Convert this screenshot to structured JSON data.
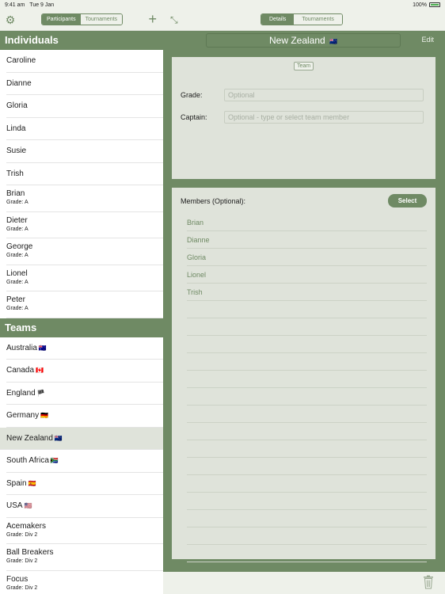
{
  "status_bar": {
    "time": "9:41 am",
    "date": "Tue 9 Jan",
    "battery": "100%"
  },
  "left_nav": {
    "segments": [
      "Participants",
      "Tournaments"
    ],
    "active_segment": 0,
    "add_symbol": "+"
  },
  "individuals": {
    "header": "Individuals",
    "items": [
      {
        "name": "Caroline",
        "grade": ""
      },
      {
        "name": "Dianne",
        "grade": ""
      },
      {
        "name": "Gloria",
        "grade": ""
      },
      {
        "name": "Linda",
        "grade": ""
      },
      {
        "name": "Susie",
        "grade": ""
      },
      {
        "name": "Trish",
        "grade": ""
      },
      {
        "name": "Brian",
        "grade": "Grade: A"
      },
      {
        "name": "Dieter",
        "grade": "Grade: A"
      },
      {
        "name": "George",
        "grade": "Grade: A"
      },
      {
        "name": "Lionel",
        "grade": "Grade: A"
      },
      {
        "name": "Peter",
        "grade": "Grade: A"
      }
    ]
  },
  "teams": {
    "header": "Teams",
    "items": [
      {
        "name": "Australia",
        "flag": "🇦🇺",
        "grade": ""
      },
      {
        "name": "Canada",
        "flag": "🇨🇦",
        "grade": ""
      },
      {
        "name": "England",
        "flag": "🏴",
        "grade": ""
      },
      {
        "name": "Germany",
        "flag": "🇩🇪",
        "grade": ""
      },
      {
        "name": "New Zealand",
        "flag": "🇳🇿",
        "grade": "",
        "selected": true
      },
      {
        "name": "South Africa",
        "flag": "🇿🇦",
        "grade": ""
      },
      {
        "name": "Spain",
        "flag": "🇪🇸",
        "grade": ""
      },
      {
        "name": "USA",
        "flag": "🇺🇸",
        "grade": ""
      },
      {
        "name": "Acemakers",
        "flag": "",
        "grade": "Grade: Div 2"
      },
      {
        "name": "Ball Breakers",
        "flag": "",
        "grade": "Grade: Div 2"
      },
      {
        "name": "Focus",
        "flag": "",
        "grade": "Grade: Div 2"
      }
    ]
  },
  "right_nav": {
    "segments": [
      "Details",
      "Tournaments"
    ],
    "active_segment": 0
  },
  "detail": {
    "title": "New Zealand",
    "title_flag": "🇳🇿",
    "edit_label": "Edit",
    "type_badge": "Team",
    "grade_label": "Grade:",
    "grade_placeholder": "Optional",
    "captain_label": "Captain:",
    "captain_placeholder": "Optional - type or select team member",
    "members_label": "Members (Optional):",
    "select_label": "Select",
    "members": [
      "Brian",
      "Dianne",
      "Gloria",
      "Lionel",
      "Trish"
    ]
  },
  "colors": {
    "accent": "#6f8a64",
    "panel": "#dfe3da",
    "bar": "#eef1ea"
  }
}
